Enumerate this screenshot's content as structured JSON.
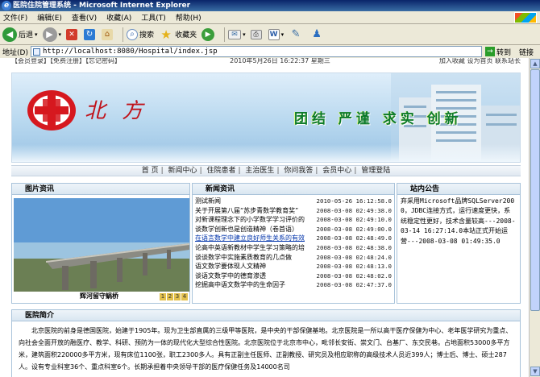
{
  "window": {
    "title": "医院住院管理系统 - Microsoft Internet Explorer"
  },
  "menu": [
    "文件(F)",
    "编辑(E)",
    "查看(V)",
    "收藏(A)",
    "工具(T)",
    "帮助(H)"
  ],
  "toolbar": {
    "back": "后退",
    "search": "搜索",
    "favorites": "收藏夹"
  },
  "address": {
    "label": "地址(D)",
    "url": "http://localhost:8080/Hospital/index.jsp",
    "go": "转到",
    "links": "链接"
  },
  "topstrip": {
    "left": "【会员登录】【免费注册】【忘记密码】",
    "date": "2010年5月26日 16:22:37 星期三",
    "right": "加入收藏 设为首页 联系站长"
  },
  "banner": {
    "name": "北 方",
    "slogan": "团结 严谨 求实 创新"
  },
  "nav": [
    "首 页",
    "新闻中心",
    "住院患者",
    "主治医生",
    "你问我答",
    "会员中心",
    "管理登陆"
  ],
  "pics": {
    "title": "图片资讯",
    "caption": "辉河留守蜗桥",
    "pages": [
      "1",
      "2",
      "3",
      "4"
    ]
  },
  "news": {
    "title": "新闻资讯",
    "items": [
      {
        "title": "测试新闻",
        "date": "2010-05-26 16:12:58.0"
      },
      {
        "title": "关于开展第八届“苏步青数学教育奖”",
        "date": "2008-03-08 02:49:38.0"
      },
      {
        "title": "对新课程理念下的小学数学学习评价的",
        "date": "2008-03-08 02:49:10.0"
      },
      {
        "title": "谈数学创新也是创造精神（卷首语）",
        "date": "2008-03-08 02:49:00.0"
      },
      {
        "title": "在语言数学中建立良好师生关系的有效",
        "date": "2008-03-08 02:48:49.0"
      },
      {
        "title": "论高中英语新教材中学生学习策略的培",
        "date": "2008-03-08 02:48:38.0"
      },
      {
        "title": "谈谈数学中实施素质教育的几点做",
        "date": "2008-03-08 02:48:24.0"
      },
      {
        "title": "语文数学要体现人文精神",
        "date": "2008-03-08 02:48:13.0"
      },
      {
        "title": "谈语文数学中的德育渗透",
        "date": "2008-03-08 02:48:02.0"
      },
      {
        "title": "挖掘高中语文数学中的生命因子",
        "date": "2008-03-08 02:47:37.0"
      }
    ]
  },
  "notice": {
    "title": "站内公告",
    "text": "弃采用Microsoft品牌SQLServer2000，JDBC连接方式，运行速度更快，系统稳定性更好，技术含量较高---2008-03-14 16:27:14.0本站正式开始运营---2008-03-08 01:49:35.0"
  },
  "intro": {
    "title": "医院简介",
    "text": "北京医院的前身是德国医院，始建于1905年。现为卫生部直属的三级甲等医院，是中央的干部保健基地。北京医院是一所以高干医疗保健为中心、老年医学研究为重点、向社会全面开放的融医疗、教学、科研、预防为一体的现代化大型综合性医院。北京医院位于北京市中心，毗邻长安街、崇文门、台基厂、东交民巷。占地面积53000多平方米，建筑面积220000多平方米，现有床位1100张，职工2300多人。具有正副主任医师、正副教授、研究员及相应职称的高级技术人员近399人；博士后、博士、硕士287人。设有专业科室36个、重点科室6个。长期承担着中央领导干部的医疗保健任务及14000名司"
  }
}
